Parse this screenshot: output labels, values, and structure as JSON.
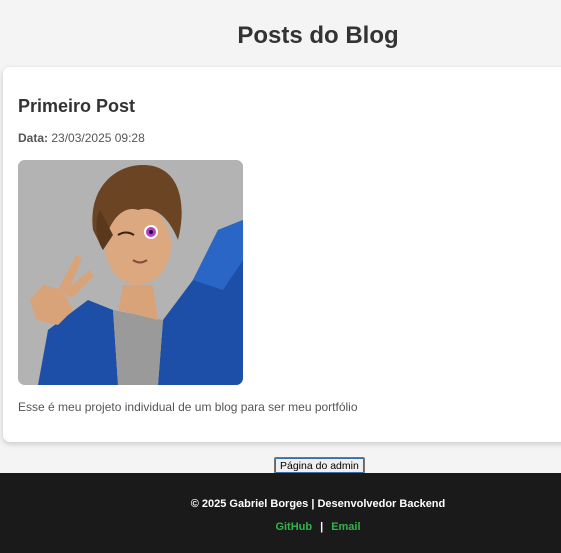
{
  "page": {
    "title": "Posts do Blog"
  },
  "post": {
    "title": "Primeiro Post",
    "date_label": "Data:",
    "date_value": "23/03/2025 09:28",
    "text": "Esse é meu projeto individual de um blog para ser meu portfólio"
  },
  "admin_button": {
    "label": "Página do admin"
  },
  "footer": {
    "text": "© 2025 Gabriel Borges | Desenvolvedor Backend",
    "links": {
      "github": "GitHub",
      "separator": "|",
      "email": "Email"
    }
  },
  "colors": {
    "background": "#f4f4f4",
    "card": "#ffffff",
    "footer": "#1a1a1a",
    "link": "#34b34a"
  }
}
